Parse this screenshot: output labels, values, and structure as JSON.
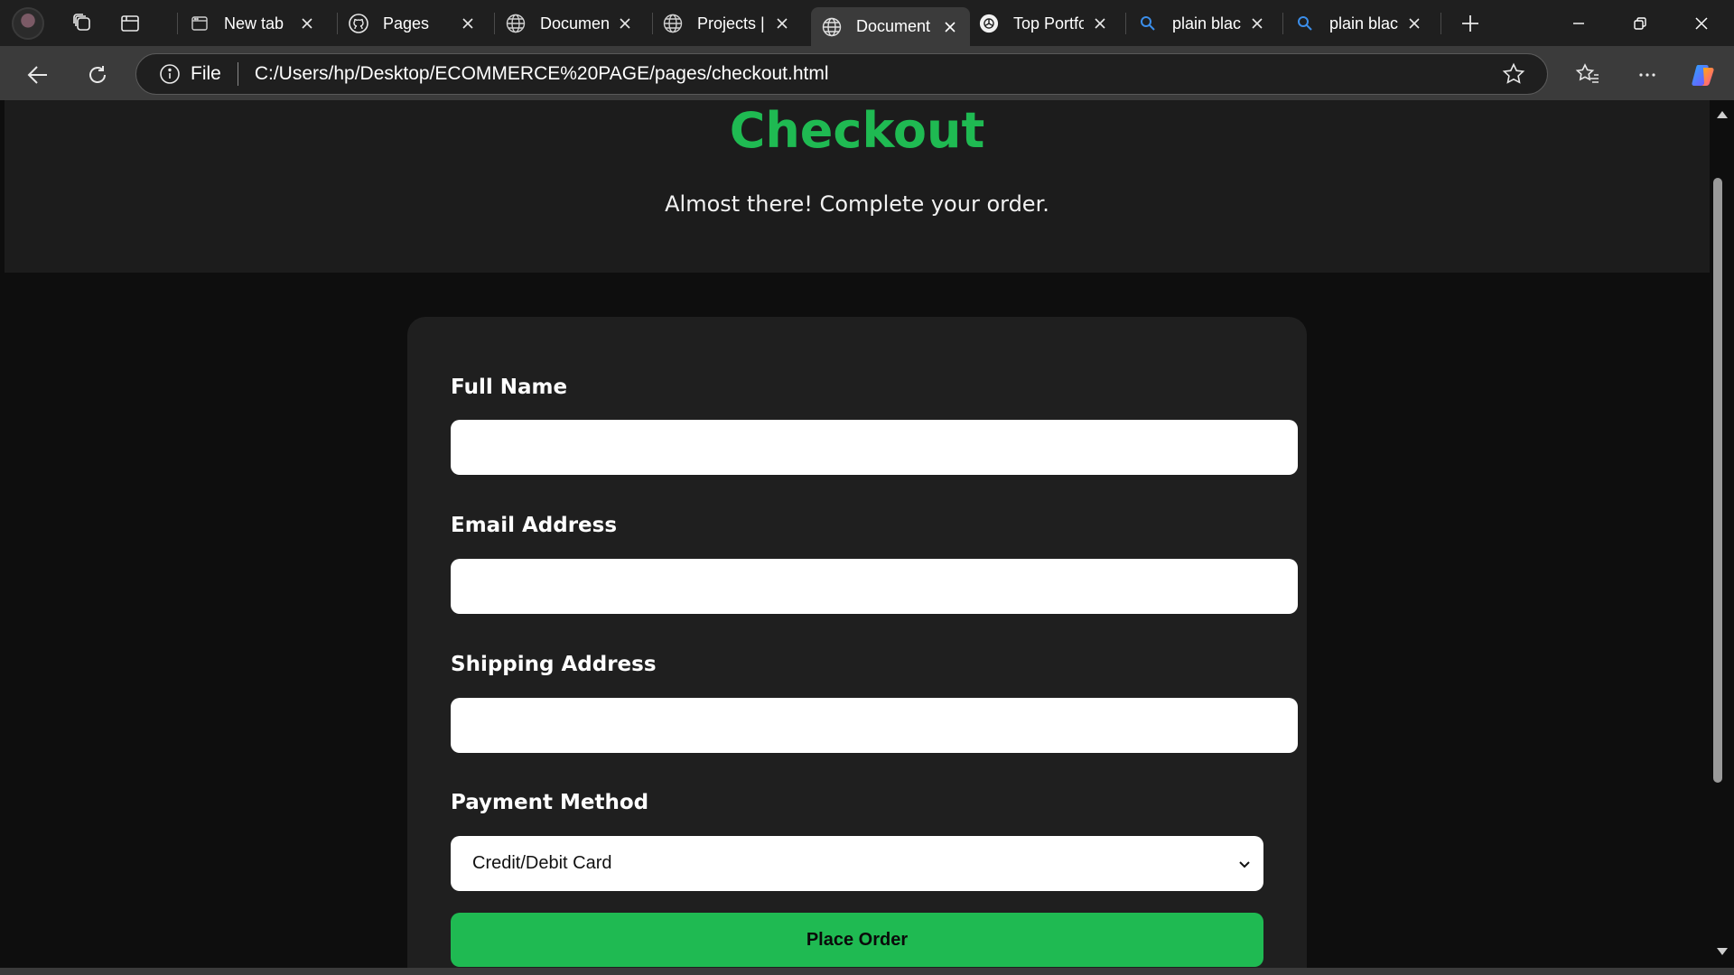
{
  "browser": {
    "tabs": [
      {
        "label": "New tab",
        "icon": "new-tab-icon"
      },
      {
        "label": "Pages",
        "icon": "github-icon"
      },
      {
        "label": "Document",
        "icon": "globe-icon"
      },
      {
        "label": "Projects | C",
        "icon": "globe-icon"
      },
      {
        "label": "Document",
        "icon": "globe-icon",
        "active": true
      },
      {
        "label": "Top Portfo",
        "icon": "openai-icon"
      },
      {
        "label": "plain black",
        "icon": "search-icon"
      },
      {
        "label": "plain black",
        "icon": "search-icon"
      }
    ],
    "address": {
      "scheme_label": "File",
      "url": "C:/Users/hp/Desktop/ECOMMERCE%20PAGE/pages/checkout.html"
    }
  },
  "page": {
    "title": "Checkout",
    "subtitle": "Almost there! Complete your order.",
    "form": {
      "full_name": {
        "label": "Full Name",
        "value": "",
        "placeholder": ""
      },
      "email": {
        "label": "Email Address",
        "value": "",
        "placeholder": ""
      },
      "shipping": {
        "label": "Shipping Address",
        "value": "",
        "placeholder": ""
      },
      "payment": {
        "label": "Payment Method",
        "selected": "Credit/Debit Card"
      },
      "submit_label": "Place Order"
    }
  },
  "colors": {
    "accent": "#1fba52",
    "header_band": "#1c1c1c",
    "page_bg": "#0e0e0e",
    "card_bg": "#1f1f1f"
  }
}
